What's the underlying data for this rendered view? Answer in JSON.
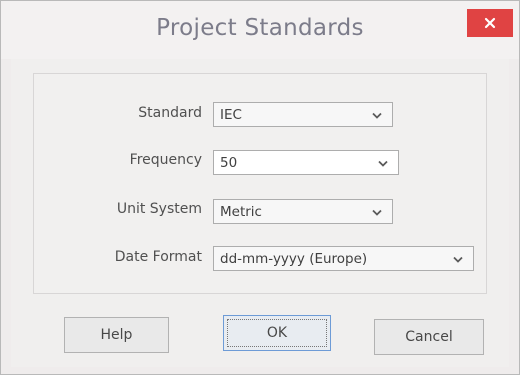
{
  "window": {
    "title": "Project Standards",
    "close_icon": "close-icon"
  },
  "form": {
    "standard": {
      "label": "Standard",
      "value": "IEC"
    },
    "frequency": {
      "label": "Frequency",
      "value": "50"
    },
    "unit_system": {
      "label": "Unit System",
      "value": "Metric"
    },
    "date_format": {
      "label": "Date Format",
      "value": "dd-mm-yyyy (Europe)"
    }
  },
  "buttons": {
    "help": "Help",
    "ok": "OK",
    "cancel": "Cancel"
  },
  "colors": {
    "close_button": "#e04343",
    "title_text": "#7c7c8a",
    "default_button_border": "#6d9bd6"
  }
}
